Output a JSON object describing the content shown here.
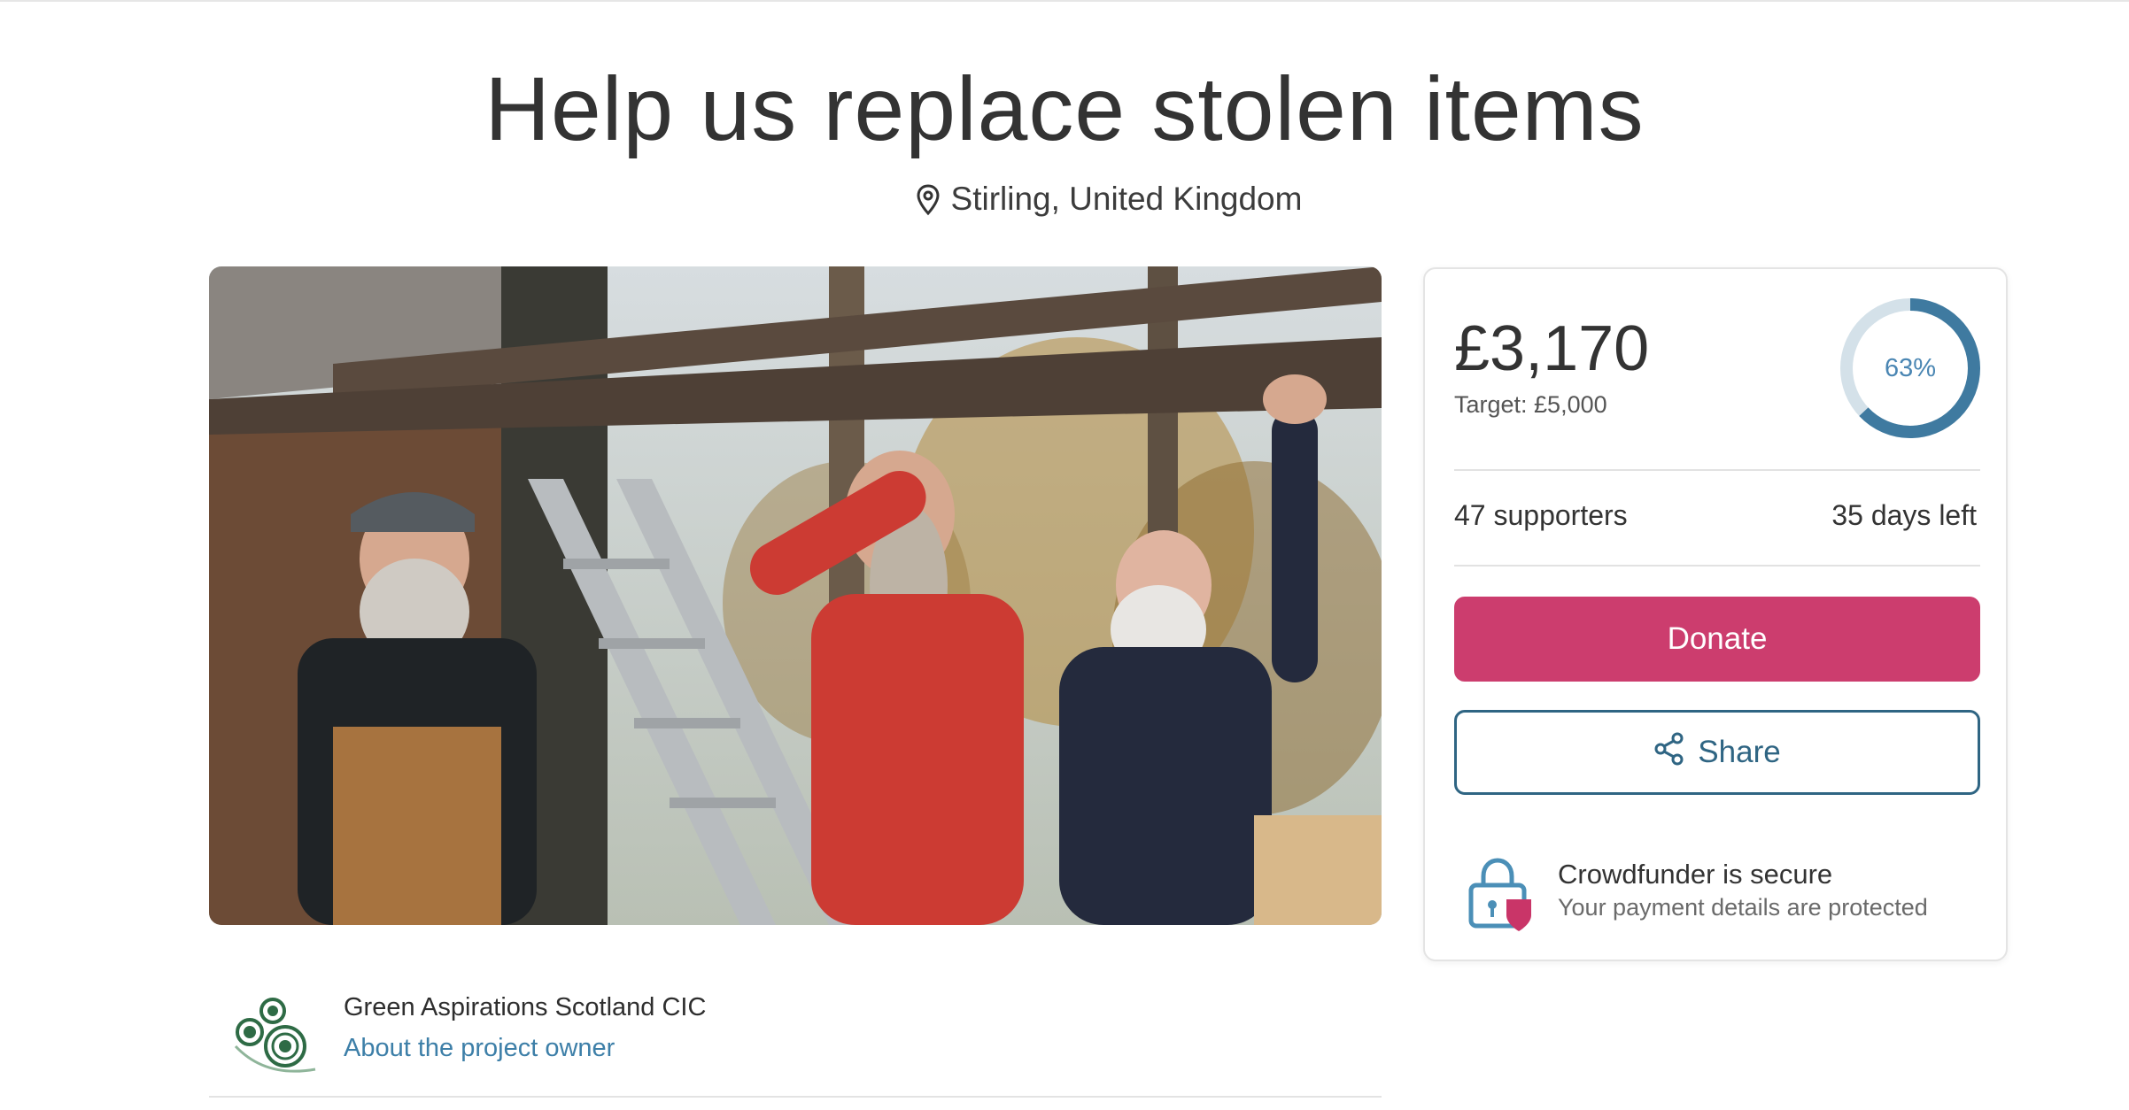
{
  "page": {
    "title": "Help us replace stolen items",
    "location": "Stirling, United Kingdom"
  },
  "photo": {
    "description_icon": "campaign-photo"
  },
  "owner": {
    "name": "Green Aspirations Scotland CIC",
    "link_label": "About the project owner"
  },
  "funding": {
    "raised": "£3,170",
    "target": "Target: £5,000",
    "percent_label": "63%",
    "percent": 0.63,
    "supporters": "47 supporters",
    "days_left": "35 days left"
  },
  "actions": {
    "donate_label": "Donate",
    "share_label": "Share"
  },
  "secure": {
    "title": "Crowdfunder is secure",
    "subtitle": "Your payment details are protected"
  },
  "colors": {
    "donate": "#cc3d6e",
    "share_border": "#2f6583",
    "ring_fill": "#3f7aa0",
    "ring_track": "#d4e1e9",
    "link": "#3d7fa8"
  }
}
